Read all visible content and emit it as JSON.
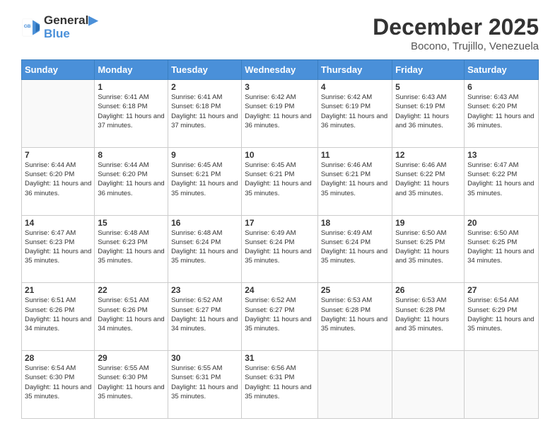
{
  "header": {
    "logo_line1": "General",
    "logo_line2": "Blue",
    "month": "December 2025",
    "location": "Bocono, Trujillo, Venezuela"
  },
  "weekdays": [
    "Sunday",
    "Monday",
    "Tuesday",
    "Wednesday",
    "Thursday",
    "Friday",
    "Saturday"
  ],
  "weeks": [
    [
      {
        "day": "",
        "info": ""
      },
      {
        "day": "1",
        "info": "Sunrise: 6:41 AM\nSunset: 6:18 PM\nDaylight: 11 hours and 37 minutes."
      },
      {
        "day": "2",
        "info": "Sunrise: 6:41 AM\nSunset: 6:18 PM\nDaylight: 11 hours and 37 minutes."
      },
      {
        "day": "3",
        "info": "Sunrise: 6:42 AM\nSunset: 6:19 PM\nDaylight: 11 hours and 36 minutes."
      },
      {
        "day": "4",
        "info": "Sunrise: 6:42 AM\nSunset: 6:19 PM\nDaylight: 11 hours and 36 minutes."
      },
      {
        "day": "5",
        "info": "Sunrise: 6:43 AM\nSunset: 6:19 PM\nDaylight: 11 hours and 36 minutes."
      },
      {
        "day": "6",
        "info": "Sunrise: 6:43 AM\nSunset: 6:20 PM\nDaylight: 11 hours and 36 minutes."
      }
    ],
    [
      {
        "day": "7",
        "info": "Sunrise: 6:44 AM\nSunset: 6:20 PM\nDaylight: 11 hours and 36 minutes."
      },
      {
        "day": "8",
        "info": "Sunrise: 6:44 AM\nSunset: 6:20 PM\nDaylight: 11 hours and 36 minutes."
      },
      {
        "day": "9",
        "info": "Sunrise: 6:45 AM\nSunset: 6:21 PM\nDaylight: 11 hours and 35 minutes."
      },
      {
        "day": "10",
        "info": "Sunrise: 6:45 AM\nSunset: 6:21 PM\nDaylight: 11 hours and 35 minutes."
      },
      {
        "day": "11",
        "info": "Sunrise: 6:46 AM\nSunset: 6:21 PM\nDaylight: 11 hours and 35 minutes."
      },
      {
        "day": "12",
        "info": "Sunrise: 6:46 AM\nSunset: 6:22 PM\nDaylight: 11 hours and 35 minutes."
      },
      {
        "day": "13",
        "info": "Sunrise: 6:47 AM\nSunset: 6:22 PM\nDaylight: 11 hours and 35 minutes."
      }
    ],
    [
      {
        "day": "14",
        "info": "Sunrise: 6:47 AM\nSunset: 6:23 PM\nDaylight: 11 hours and 35 minutes."
      },
      {
        "day": "15",
        "info": "Sunrise: 6:48 AM\nSunset: 6:23 PM\nDaylight: 11 hours and 35 minutes."
      },
      {
        "day": "16",
        "info": "Sunrise: 6:48 AM\nSunset: 6:24 PM\nDaylight: 11 hours and 35 minutes."
      },
      {
        "day": "17",
        "info": "Sunrise: 6:49 AM\nSunset: 6:24 PM\nDaylight: 11 hours and 35 minutes."
      },
      {
        "day": "18",
        "info": "Sunrise: 6:49 AM\nSunset: 6:24 PM\nDaylight: 11 hours and 35 minutes."
      },
      {
        "day": "19",
        "info": "Sunrise: 6:50 AM\nSunset: 6:25 PM\nDaylight: 11 hours and 35 minutes."
      },
      {
        "day": "20",
        "info": "Sunrise: 6:50 AM\nSunset: 6:25 PM\nDaylight: 11 hours and 34 minutes."
      }
    ],
    [
      {
        "day": "21",
        "info": "Sunrise: 6:51 AM\nSunset: 6:26 PM\nDaylight: 11 hours and 34 minutes."
      },
      {
        "day": "22",
        "info": "Sunrise: 6:51 AM\nSunset: 6:26 PM\nDaylight: 11 hours and 34 minutes."
      },
      {
        "day": "23",
        "info": "Sunrise: 6:52 AM\nSunset: 6:27 PM\nDaylight: 11 hours and 34 minutes."
      },
      {
        "day": "24",
        "info": "Sunrise: 6:52 AM\nSunset: 6:27 PM\nDaylight: 11 hours and 35 minutes."
      },
      {
        "day": "25",
        "info": "Sunrise: 6:53 AM\nSunset: 6:28 PM\nDaylight: 11 hours and 35 minutes."
      },
      {
        "day": "26",
        "info": "Sunrise: 6:53 AM\nSunset: 6:28 PM\nDaylight: 11 hours and 35 minutes."
      },
      {
        "day": "27",
        "info": "Sunrise: 6:54 AM\nSunset: 6:29 PM\nDaylight: 11 hours and 35 minutes."
      }
    ],
    [
      {
        "day": "28",
        "info": "Sunrise: 6:54 AM\nSunset: 6:30 PM\nDaylight: 11 hours and 35 minutes."
      },
      {
        "day": "29",
        "info": "Sunrise: 6:55 AM\nSunset: 6:30 PM\nDaylight: 11 hours and 35 minutes."
      },
      {
        "day": "30",
        "info": "Sunrise: 6:55 AM\nSunset: 6:31 PM\nDaylight: 11 hours and 35 minutes."
      },
      {
        "day": "31",
        "info": "Sunrise: 6:56 AM\nSunset: 6:31 PM\nDaylight: 11 hours and 35 minutes."
      },
      {
        "day": "",
        "info": ""
      },
      {
        "day": "",
        "info": ""
      },
      {
        "day": "",
        "info": ""
      }
    ]
  ]
}
